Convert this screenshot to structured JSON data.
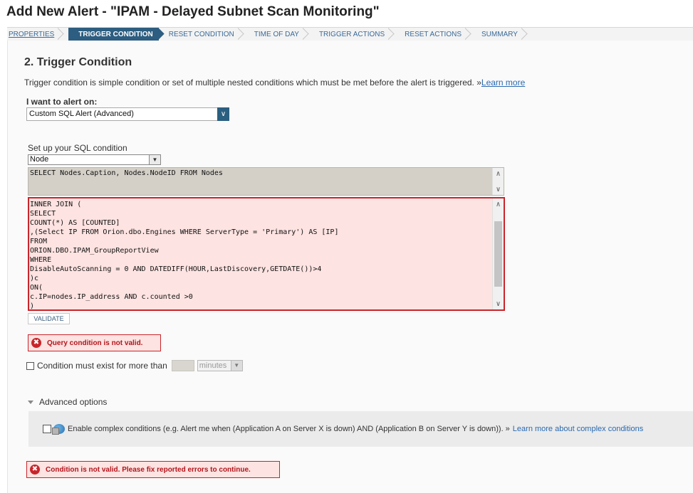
{
  "page": {
    "title": "Add New Alert - \"IPAM - Delayed Subnet Scan Monitoring\""
  },
  "wizard": {
    "steps": [
      {
        "label": "PROPERTIES"
      },
      {
        "label": "TRIGGER CONDITION"
      },
      {
        "label": "RESET CONDITION"
      },
      {
        "label": "TIME OF DAY"
      },
      {
        "label": "TRIGGER ACTIONS"
      },
      {
        "label": "RESET ACTIONS"
      },
      {
        "label": "SUMMARY"
      }
    ],
    "active_step": "TRIGGER CONDITION"
  },
  "trigger": {
    "heading": "2. Trigger Condition",
    "description": "Trigger condition is simple condition or set of multiple nested conditions which must be met before the alert is triggered. »",
    "learn_more": "Learn more",
    "alert_on_label": "I want to alert on:",
    "alert_on_value": "Custom SQL Alert (Advanced)",
    "sql_setup_label": "Set up your SQL condition",
    "object_type_value": "Node",
    "sql_prefix": "SELECT Nodes.Caption, Nodes.NodeID FROM Nodes",
    "sql_lines": [
      "INNER JOIN (",
      "SELECT",
      "COUNT(*) AS [COUNTED]",
      ",(Select IP FROM Orion.dbo.Engines WHERE ServerType = 'Primary') AS [IP]",
      "FROM",
      "ORION.DBO.IPAM_GroupReportView",
      "WHERE",
      "DisableAutoScanning = 0 AND DATEDIFF(HOUR,LastDiscovery,GETDATE())>4",
      ")c",
      "ON(",
      "c.IP=nodes.IP_address AND c.counted >0",
      ")"
    ],
    "validate_label": "VALIDATE",
    "query_error": "Query condition is not valid.",
    "condition_exist_label": "Condition must exist for more than",
    "duration_value": "",
    "duration_unit": "minutes"
  },
  "advanced": {
    "toggle_label": "Advanced options",
    "complex_label": "Enable complex conditions (e.g. Alert me when (Application A on Server X is down) AND (Application B on Server Y is down)). »",
    "complex_link": "Learn more about complex conditions"
  },
  "footer_error": "Condition is not valid. Please fix reported errors to continue.",
  "colors": {
    "active_step_bg": "#2d5d80",
    "error_red": "#c8252b",
    "error_bg": "#fde3e1",
    "link_blue": "#2a6ab0"
  },
  "icons": [
    "error-icon",
    "chevron-down-icon",
    "application-icon",
    "triangle-down-icon"
  ]
}
